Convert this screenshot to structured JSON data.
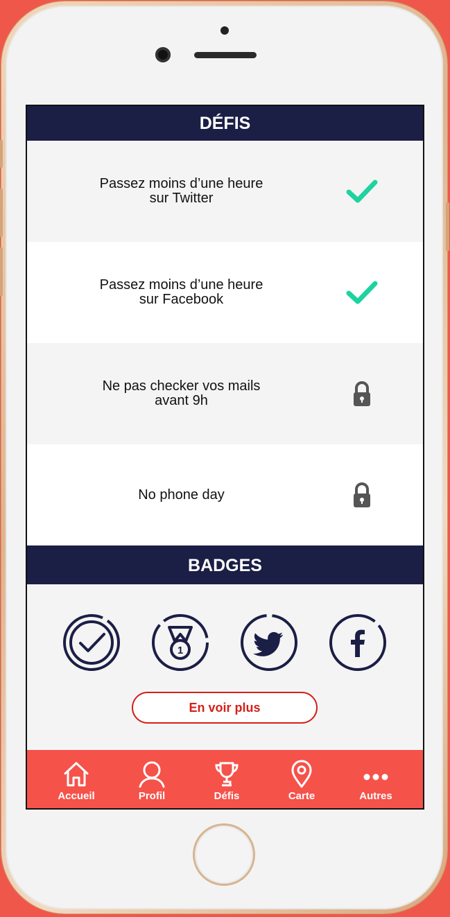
{
  "defis": {
    "title": "DÉFIS",
    "items": [
      {
        "label": "Passez moins d’une heure\nsur Twitter",
        "status": "check-icon"
      },
      {
        "label": "Passez moins d’une heure\nsur Facebook",
        "status": "check-icon"
      },
      {
        "label": "Ne pas checker vos mails\navant 9h",
        "status": "lock-icon"
      },
      {
        "label": "No phone day",
        "status": "lock-icon"
      }
    ]
  },
  "badges": {
    "title": "BADGES",
    "items": [
      "checkmark-badge-icon",
      "medal-badge-icon",
      "twitter-badge-icon",
      "facebook-badge-icon"
    ],
    "more_label": "En voir plus"
  },
  "tabbar": {
    "items": [
      {
        "label": "Accueil",
        "icon": "home-icon"
      },
      {
        "label": "Profil",
        "icon": "profile-icon"
      },
      {
        "label": "Défis",
        "icon": "trophy-icon"
      },
      {
        "label": "Carte",
        "icon": "map-pin-icon"
      },
      {
        "label": "Autres",
        "icon": "more-icon"
      }
    ]
  },
  "colors": {
    "navy": "#1b1e45",
    "accent_red": "#f5524a",
    "button_red": "#d32019",
    "check_green": "#1ed3a0",
    "lock_gray": "#555555"
  }
}
